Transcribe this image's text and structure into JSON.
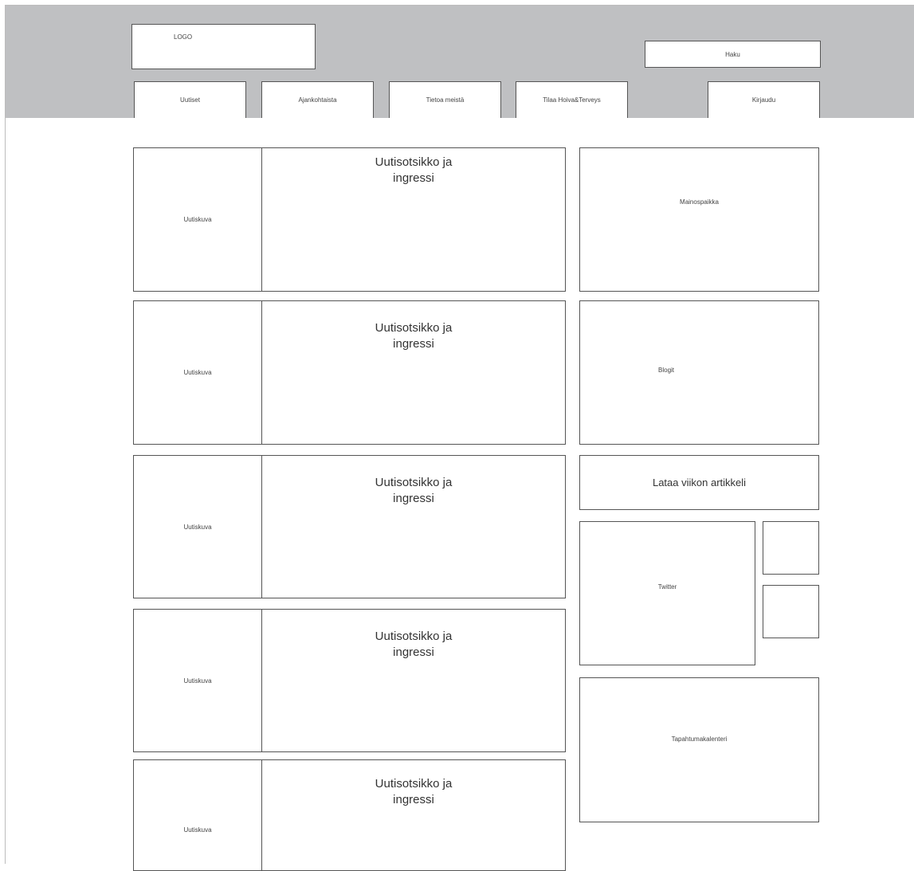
{
  "header": {
    "logo_label": "LOGO",
    "search_label": "Haku",
    "nav": [
      {
        "label": "Uutiset"
      },
      {
        "label": "Ajankohtaista"
      },
      {
        "label": "Tietoa meistä"
      },
      {
        "label": "Tilaa Hoiva&Terveys"
      }
    ],
    "login_label": "Kirjaudu"
  },
  "news": [
    {
      "image_label": "Uutiskuva",
      "title_line1": "Uutisotsikko ja",
      "title_line2": "ingressi"
    },
    {
      "image_label": "Uutiskuva",
      "title_line1": "Uutisotsikko ja",
      "title_line2": "ingressi"
    },
    {
      "image_label": "Uutiskuva",
      "title_line1": "Uutisotsikko ja",
      "title_line2": "ingressi"
    },
    {
      "image_label": "Uutiskuva",
      "title_line1": "Uutisotsikko ja",
      "title_line2": "ingressi"
    },
    {
      "image_label": "Uutiskuva",
      "title_line1": "Uutisotsikko ja",
      "title_line2": "ingressi"
    }
  ],
  "sidebar": {
    "ad_label": "Mainospaikka",
    "blogs_label": "Blogit",
    "download_label": "Lataa viikon artikkeli",
    "twitter_label": "Twitter",
    "calendar_label": "Tapahtumakalenteri"
  }
}
